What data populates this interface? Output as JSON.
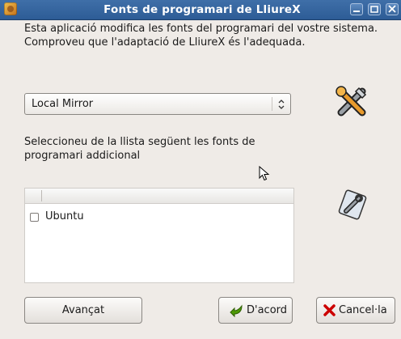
{
  "window": {
    "title": "Fonts de programari de LliureX",
    "icons": {
      "app": "lliurex-app-icon",
      "minimize": "minimize-icon",
      "maximize": "maximize-icon",
      "close": "close-icon"
    }
  },
  "description": {
    "line1": "Esta aplicació modifica les fonts del programari del vostre sistema.",
    "line2": "Comproveu que l'adaptació de LliureX és l'adequada."
  },
  "mirror_select": {
    "value": "Local Mirror"
  },
  "additional": {
    "label_line1": "Seleccioneu de la llista següent les fonts de",
    "label_line2": "programari addicional"
  },
  "sources_list": {
    "columns": [
      "",
      ""
    ],
    "rows": [
      {
        "label": "Ubuntu",
        "checked": false
      }
    ]
  },
  "buttons": {
    "advanced": "Avançat",
    "ok": "D'acord",
    "cancel": "Cancel·la"
  },
  "icons": {
    "tools": "tools-icon",
    "edit": "edit-icon",
    "ok": "ok-icon",
    "cancel": "cancel-icon"
  },
  "colors": {
    "titlebar": "#3b6aa3",
    "window_bg": "#efebe7"
  }
}
